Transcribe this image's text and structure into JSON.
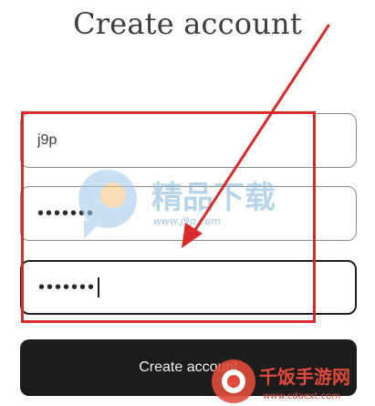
{
  "form": {
    "title": "Create account",
    "username_value": "j9p",
    "password_value": "•••••••",
    "confirm_password_value": "•••••••",
    "submit_label": "Create account"
  },
  "watermark_center": {
    "text_cn": "精品下载",
    "url": "www.j9p.com"
  },
  "watermark_corner": {
    "text_cn": "千饭手游网",
    "url": "www.cdaext.com"
  },
  "colors": {
    "annotation_red": "#d92b2b",
    "button_dark": "#1c1c1c",
    "field_border": "#8c8c8c"
  }
}
